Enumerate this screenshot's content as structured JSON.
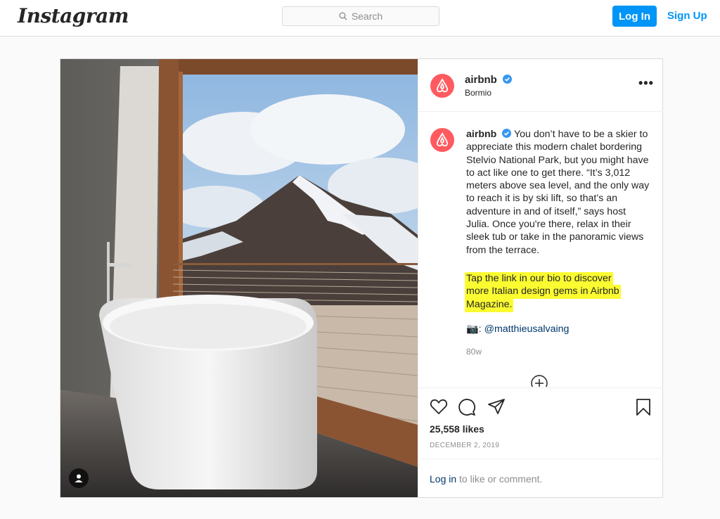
{
  "header": {
    "logo": "Instagram",
    "search_placeholder": "Search",
    "login_label": "Log In",
    "signup_label": "Sign Up"
  },
  "post": {
    "username": "airbnb",
    "location": "Bormio",
    "more_label": "•••",
    "caption_username": "airbnb",
    "caption_text": "You don’t have to be a skier to appreciate this modern chalet bordering Stelvio National Park, but you might have to act like one to get there. “It’s 3,012 meters above sea level, and the only way to reach it is by ski lift, so that’s an adventure in and of itself,” says host Julia. Once you're there, relax in their sleek tub or take in the panoramic views from the terrace.",
    "cta_text": "Tap the link in our bio to discover more Italian design gems in Airbnb Magazine.",
    "credit_icon": "📷:",
    "credit_handle": "@matthieusalvaing",
    "time_ago": "80w",
    "likes": "25,558 likes",
    "date": "DECEMBER 2, 2019",
    "comment_login": "Log in",
    "comment_rest": " to like or comment."
  },
  "colors": {
    "brand_blue": "#0095f6",
    "airbnb_red": "#ff5a5f",
    "highlight_yellow": "#fbfb31",
    "verified_blue": "#3897f0"
  },
  "icons": [
    "search-icon",
    "verified-icon",
    "more-icon",
    "heart-icon",
    "comment-icon",
    "share-icon",
    "bookmark-icon",
    "plus-circle-icon",
    "user-tag-icon"
  ]
}
